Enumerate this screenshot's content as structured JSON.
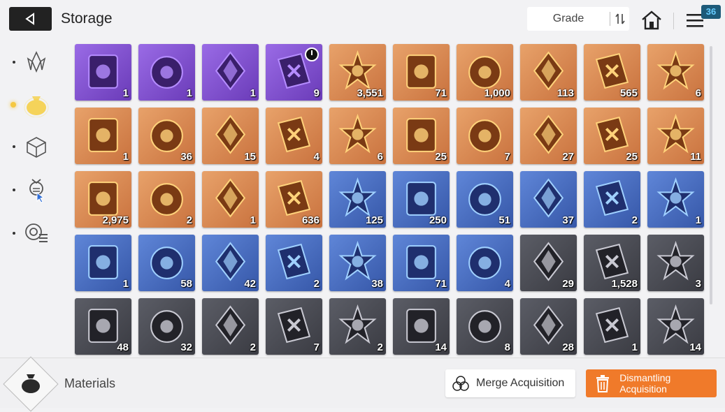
{
  "header": {
    "title": "Storage",
    "sort_label": "Grade",
    "badge": "36"
  },
  "sidebar": {
    "items": [
      "crystal-icon",
      "pouch-icon",
      "cube-icon",
      "flask-icon",
      "gear-list-icon"
    ],
    "active_index": 1
  },
  "items": [
    {
      "name": "card-pack",
      "rarity": "purple",
      "count": "1"
    },
    {
      "name": "stone-golem",
      "rarity": "purple",
      "count": "1"
    },
    {
      "name": "lava-rock",
      "rarity": "purple",
      "count": "1"
    },
    {
      "name": "pyramid-core",
      "rarity": "purple",
      "count": "9",
      "alert": true
    },
    {
      "name": "blue-creature",
      "rarity": "orange",
      "count": "3,551"
    },
    {
      "name": "cyan-orb",
      "rarity": "orange",
      "count": "71"
    },
    {
      "name": "dark-chip",
      "rarity": "orange",
      "count": "1,000"
    },
    {
      "name": "gold-ticket",
      "rarity": "orange",
      "count": "113"
    },
    {
      "name": "gold-pass",
      "rarity": "orange",
      "count": "565"
    },
    {
      "name": "purple-eye",
      "rarity": "orange",
      "count": "6"
    },
    {
      "name": "gold-feather",
      "rarity": "orange",
      "count": "1"
    },
    {
      "name": "purple-crystal",
      "rarity": "orange",
      "count": "36"
    },
    {
      "name": "book-swords",
      "rarity": "orange",
      "count": "15"
    },
    {
      "name": "book-eye",
      "rarity": "orange",
      "count": "4"
    },
    {
      "name": "book-cross",
      "rarity": "orange",
      "count": "6"
    },
    {
      "name": "book-bolt",
      "rarity": "orange",
      "count": "25"
    },
    {
      "name": "book-globe",
      "rarity": "orange",
      "count": "7"
    },
    {
      "name": "medal-sword",
      "rarity": "orange",
      "count": "27"
    },
    {
      "name": "medal-bolt",
      "rarity": "orange",
      "count": "25"
    },
    {
      "name": "medal-target",
      "rarity": "orange",
      "count": "11"
    },
    {
      "name": "gold-leaves",
      "rarity": "orange",
      "count": "2,975"
    },
    {
      "name": "blue-cube",
      "rarity": "orange",
      "count": "2"
    },
    {
      "name": "spray-gun",
      "rarity": "orange",
      "count": "1"
    },
    {
      "name": "music-scroll",
      "rarity": "orange",
      "count": "636"
    },
    {
      "name": "silver-ticket",
      "rarity": "blue",
      "count": "125"
    },
    {
      "name": "silver-pass",
      "rarity": "blue",
      "count": "250"
    },
    {
      "name": "violet-shard",
      "rarity": "blue",
      "count": "51"
    },
    {
      "name": "green-shard",
      "rarity": "blue",
      "count": "37"
    },
    {
      "name": "blue-shard",
      "rarity": "blue",
      "count": "2"
    },
    {
      "name": "blue-book-swords",
      "rarity": "blue",
      "count": "1"
    },
    {
      "name": "blue-book-cross",
      "rarity": "blue",
      "count": "1"
    },
    {
      "name": "silver-medal-a",
      "rarity": "blue",
      "count": "58"
    },
    {
      "name": "silver-medal-b",
      "rarity": "blue",
      "count": "42"
    },
    {
      "name": "silver-medal-c",
      "rarity": "blue",
      "count": "2"
    },
    {
      "name": "silver-medal-d",
      "rarity": "blue",
      "count": "38"
    },
    {
      "name": "ice-crystal",
      "rarity": "blue",
      "count": "71"
    },
    {
      "name": "cake-slice",
      "rarity": "blue",
      "count": "4"
    },
    {
      "name": "gray-ticket",
      "rarity": "gray",
      "count": "29"
    },
    {
      "name": "gray-pass",
      "rarity": "gray",
      "count": "1,528"
    },
    {
      "name": "pink-shard",
      "rarity": "gray",
      "count": "3"
    },
    {
      "name": "violet-shard-small",
      "rarity": "gray",
      "count": "48"
    },
    {
      "name": "green-shard-small",
      "rarity": "gray",
      "count": "32"
    },
    {
      "name": "blue-shard-small",
      "rarity": "gray",
      "count": "2"
    },
    {
      "name": "brown-book-eye",
      "rarity": "gray",
      "count": "7"
    },
    {
      "name": "brown-book-cross",
      "rarity": "gray",
      "count": "2"
    },
    {
      "name": "brown-book-bolt",
      "rarity": "gray",
      "count": "14"
    },
    {
      "name": "brown-book-globe",
      "rarity": "gray",
      "count": "8"
    },
    {
      "name": "bronze-medal-a",
      "rarity": "gray",
      "count": "28"
    },
    {
      "name": "bronze-medal-b",
      "rarity": "gray",
      "count": "1"
    },
    {
      "name": "bronze-medal-c",
      "rarity": "gray",
      "count": "14"
    }
  ],
  "footer": {
    "category_label": "Materials",
    "merge_label": "Merge Acquisition",
    "dismantle_label": "Dismantling Acquisition"
  }
}
